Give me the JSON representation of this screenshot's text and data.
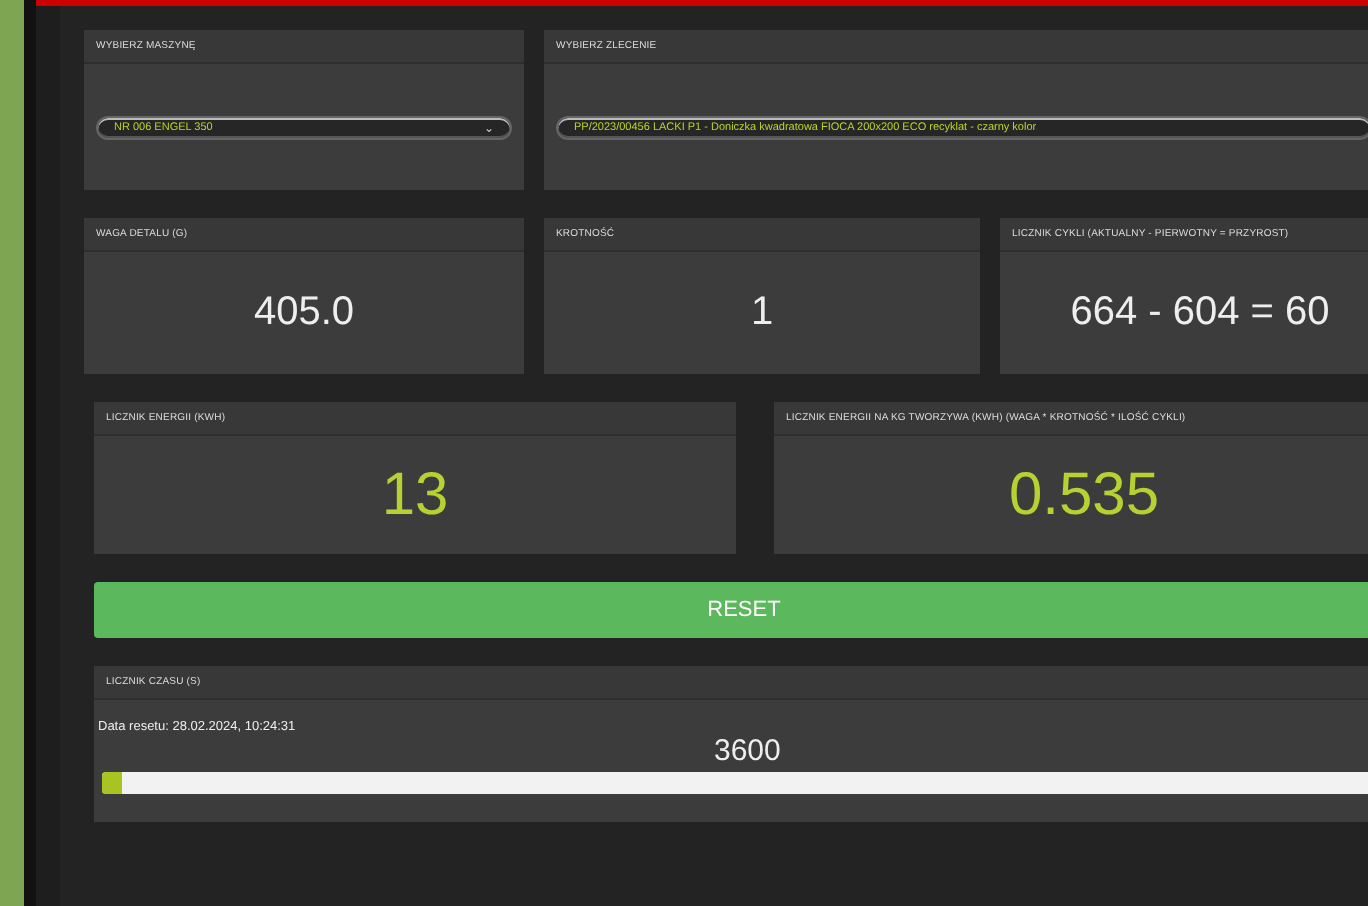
{
  "selectors": [
    {
      "label": "WYBIERZ MASZYNĘ",
      "value": "NR 006 ENGEL 350",
      "caret": "⌄"
    },
    {
      "label": "WYBIERZ ZLECENIE",
      "value": "PP/2023/00456 LACKI P1 - Doniczka kwadratowa FIOCA 200x200 ECO recyklat - czarny kolor"
    }
  ],
  "stats": [
    {
      "label": "WAGA DETALU (G)",
      "value": "405.0",
      "highlighted": false
    },
    {
      "label": "KROTNOŚĆ",
      "value": "1",
      "highlighted": false
    },
    {
      "label": "LICZNIK CYKLI (AKTUALNY - PIERWOTNY = PRZYROST)",
      "value": "664 - 604 = 60",
      "highlighted": false
    }
  ],
  "energy": [
    {
      "label": "LICZNIK ENERGII (KWH)",
      "value": "13",
      "highlighted": true
    },
    {
      "label": "LICZNIK ENERGII NA KG TWORZYWA (KWH) (WAGA * KROTNOŚĆ * ILOŚĆ CYKLI)",
      "value": "0.535",
      "highlighted": true
    }
  ],
  "reset_button": "RESET",
  "timer": {
    "label": "LICZNIK CZASU (S)",
    "reset_date": "Data resetu: 28.02.2024, 10:24:31",
    "value": "3600",
    "level": 0.016
  }
}
